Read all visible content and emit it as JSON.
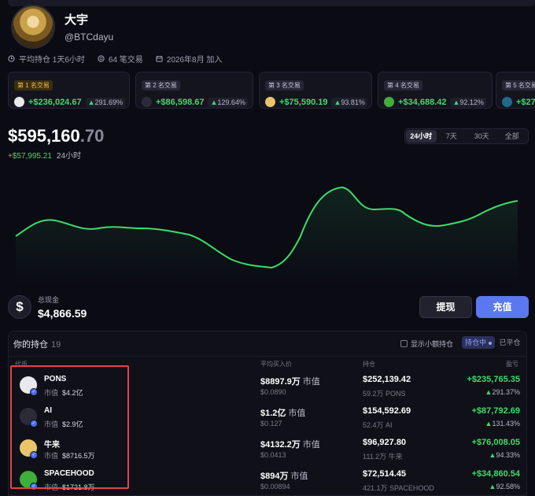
{
  "profile": {
    "name": "大宇",
    "handle": "@BTCdayu",
    "stats": [
      {
        "icon": "clock-icon",
        "text": "平均持仓 1天6小时"
      },
      {
        "icon": "swap-icon",
        "text": "64 笔交易"
      },
      {
        "icon": "calendar-icon",
        "text": "2026年8月 加入"
      }
    ]
  },
  "top_trades": [
    {
      "rank": "第 1 名交易",
      "pnl": "+$236,024.67",
      "pct": "291.69%",
      "token_color": "#e8e8ee"
    },
    {
      "rank": "第 2 名交易",
      "pnl": "+$86,598.67",
      "pct": "129.64%",
      "token_color": "#2b2b3a"
    },
    {
      "rank": "第 3 名交易",
      "pnl": "+$75,590.19",
      "pct": "93.81%",
      "token_color": "#e8c56a"
    },
    {
      "rank": "第 4 名交易",
      "pnl": "+$34,688.42",
      "pct": "92.12%",
      "token_color": "#3fae3a"
    },
    {
      "rank": "第 5 名交易",
      "pnl": "+$27",
      "pct": "",
      "token_color": "#1f6a8a"
    }
  ],
  "balance": {
    "main": "$595,160",
    "decimal": ".70",
    "change": "+$57,995.21",
    "period": "24小时"
  },
  "time_ranges": [
    "24小时",
    "7天",
    "30天",
    "全部"
  ],
  "active_range": "24小时",
  "cash": {
    "label": "总现金",
    "value": "$4,866.59",
    "withdraw_label": "提现",
    "deposit_label": "充值"
  },
  "holdings": {
    "title": "你的持仓",
    "count": "19",
    "show_small_label": "显示小额持仓",
    "tab_open": "持仓中",
    "tab_closed": "已平仓",
    "columns": {
      "token": "代币",
      "avg_buy": "平均买入价",
      "holding": "持仓",
      "pnl": "盈亏"
    },
    "mcap_label": "市值",
    "rows": [
      {
        "name": "PONS",
        "mcap": "$4.2亿",
        "avg_value": "$8897.9万",
        "avg_unit": "市值",
        "avg_price": "$0.0890",
        "hold_value": "$252,139.42",
        "hold_amount": "59.2万 PONS",
        "pnl": "+$235,765.35",
        "pnl_pct": "291.37%",
        "logo_color": "#e8e8ee"
      },
      {
        "name": "AI",
        "mcap": "$2.9亿",
        "avg_value": "$1.2亿",
        "avg_unit": "市值",
        "avg_price": "$0.127",
        "hold_value": "$154,592.69",
        "hold_amount": "52.4万 AI",
        "pnl": "+$87,792.69",
        "pnl_pct": "131.43%",
        "logo_color": "#2b2b3a"
      },
      {
        "name": "牛来",
        "mcap": "$8716.5万",
        "avg_value": "$4132.2万",
        "avg_unit": "市值",
        "avg_price": "$0.0413",
        "hold_value": "$96,927.80",
        "hold_amount": "111.2万 牛来",
        "pnl": "+$76,008.05",
        "pnl_pct": "94.33%",
        "logo_color": "#e8c56a"
      },
      {
        "name": "SPACEHOOD",
        "mcap": "$1721.8万",
        "avg_value": "$894万",
        "avg_unit": "市值",
        "avg_price": "$0.00894",
        "hold_value": "$72,514.45",
        "hold_amount": "421.1万 SPACEHOOD",
        "pnl": "+$34,860.54",
        "pnl_pct": "92.58%",
        "logo_color": "#3fae3a"
      }
    ]
  },
  "colors": {
    "accent": "#5b78f0",
    "positive": "#3ddc6a",
    "highlight": "#e24545"
  }
}
